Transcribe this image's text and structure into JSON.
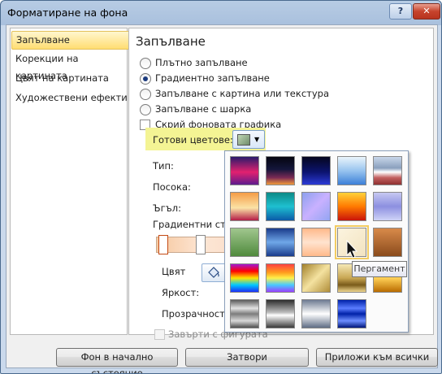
{
  "window": {
    "title": "Форматиране на фона",
    "help_label": "?",
    "close_label": "✕"
  },
  "nav": {
    "items": [
      "Запълване",
      "Корекции на картината",
      "Цвят на картината",
      "Художествени ефекти"
    ]
  },
  "panel": {
    "title": "Запълване",
    "fill_options": [
      {
        "label": "Плътно запълване",
        "selected": false
      },
      {
        "label": "Градиентно запълване",
        "selected": true
      },
      {
        "label": "Запълване с картина или текстура",
        "selected": false
      },
      {
        "label": "Запълване с шарка",
        "selected": false
      }
    ],
    "hide_background_label": "Скрий фоновата графика",
    "preset_colors_label": "Готови цветове:",
    "type_label": "Тип:",
    "direction_label": "Посока:",
    "angle_label": "Ъгъл:",
    "gradient_stops_label": "Градиентни стопове",
    "color_label": "Цвят",
    "brightness_label": "Яркост:",
    "transparency_label": "Прозрачност:",
    "rotate_with_shape_label": "Завърти с фигурата"
  },
  "gallery": {
    "selected_index": 13,
    "tooltip": "Пергамент",
    "presets": [
      "linear-gradient(#2a1b6b,#e2216f 55%,#5d1a8d)",
      "linear-gradient(#050510,#14163b 45%,#7a2a55 75%,#f09a3a)",
      "linear-gradient(#05061e,#0c1470 55%,#2b3ad6)",
      "linear-gradient(#eaf4fb,#98c4ef 50%,#3c7fd8)",
      "linear-gradient(#c9d7ea,#8aa0bd 40%,#ffffff 55%,#c36060 75%,#8e3030)",
      "linear-gradient(#f59c45,#fbe3a6 55%,#b41d47)",
      "linear-gradient(#0c8a86,#1ec0d0 50%,#0b5aa8)",
      "linear-gradient(135deg,#8da0ee,#c9b1ff 50%,#93a5f2)",
      "linear-gradient(#ffd23a,#ff7a00 50%,#c9140a)",
      "linear-gradient(#c6c8f2,#8c8fe0 50%,#cfd3f7)",
      "linear-gradient(#a0c68e,#4f8a3c)",
      "linear-gradient(#1a3b8b,#6fa7e8 50%,#1a3b8b)",
      "linear-gradient(#ffb98a,#ffe3cf 50%,#ffb98a)",
      "linear-gradient(135deg,#fcf4df,#f2e3c0)",
      "linear-gradient(#d88a4a,#8a4b1c)",
      "linear-gradient(#a416d4,#ff0000 25%,#ffe600 50%,#00c8ff 75%,#1e2cf5)",
      "linear-gradient(#ff4040,#ff9c1c 30%,#fff04a 50%,#48c9ff 75%,#9b3dff)",
      "linear-gradient(135deg,#a2802a,#f4e2a0 50%,#b08d38)",
      "linear-gradient(#f6e9b4,#c8a653 50%,#7a5b1a 75%,#f0d890)",
      "linear-gradient(#b96b00,#ffd056 50%,#b96b00)",
      "linear-gradient(#5a5a5a,#e2e2e2 30%,#7c7c7c 50%,#d8d8d8 75%,#4f4f4f)",
      "linear-gradient(#2c2c2c,#bdbdbd 45%,#ffffff 55%,#3a3a3a)",
      "linear-gradient(#6d7a92,#ffffff 50%,#5f6d85)",
      "linear-gradient(#0021a8,#5b7dff 30%,#0021a8 50%,#6d8eff 75%,#00167a)"
    ]
  },
  "buttons": {
    "reset": "Фон в начално състояние",
    "close": "Затвори",
    "apply_all": "Приложи към всички"
  }
}
